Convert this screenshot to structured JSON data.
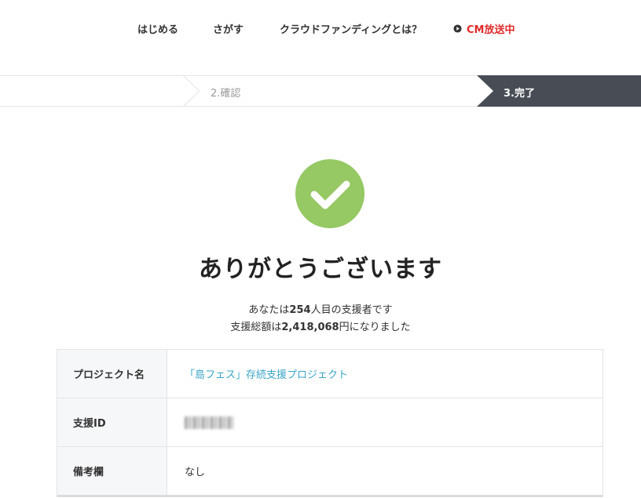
{
  "nav": {
    "items": [
      "はじめる",
      "さがす",
      "クラウドファンディングとは？"
    ],
    "cm_label": "CM放送中",
    "cm_color": "#e02a2a"
  },
  "steps": {
    "step2": "2.確認",
    "step3": "3.完了",
    "active_color": "#474c55"
  },
  "success": {
    "icon": "check-icon",
    "icon_color": "#96c864",
    "title": "ありがとうございます",
    "line1_prefix": "あなたは",
    "line1_count": "254",
    "line1_suffix": "人目の支援者です",
    "line2_prefix": "支援総額は",
    "line2_amount": "2,418,068",
    "line2_suffix": "円になりました"
  },
  "details": {
    "project_label": "プロジェクト名",
    "project_value": "「島フェス」存続支援プロジェクト",
    "support_id_label": "支援ID",
    "remarks_label": "備考欄",
    "remarks_value": "なし",
    "link_color": "#3ba5c8"
  }
}
